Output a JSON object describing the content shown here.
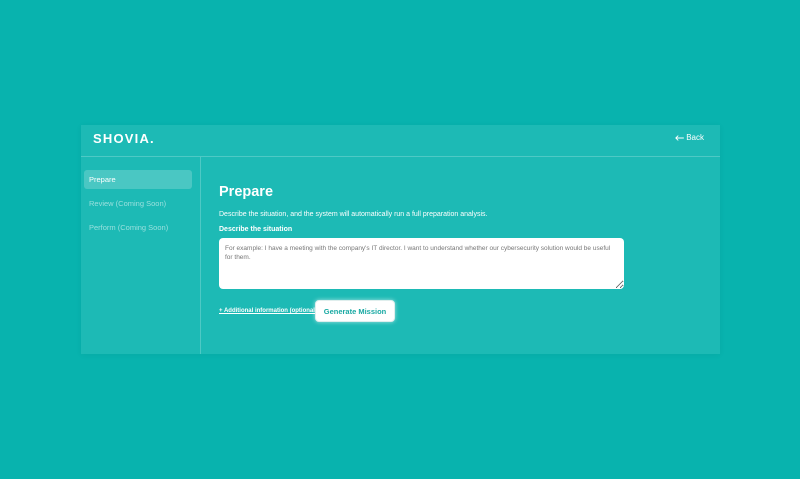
{
  "header": {
    "logo": "SHOVIA.",
    "back_label": "Back",
    "back_icon": "arrow-left-icon"
  },
  "sidebar": {
    "items": [
      {
        "label": "Prepare",
        "active": true
      },
      {
        "label": "Review (Coming Soon)",
        "active": false
      },
      {
        "label": "Perform (Coming Soon)",
        "active": false
      }
    ]
  },
  "main": {
    "title": "Prepare",
    "description": "Describe the situation, and the system will automatically run a full preparation analysis.",
    "field_label": "Describe the situation",
    "input_placeholder": "For example: I have a meeting with the company's IT director. I want to understand whether our cybersecurity solution would be useful for them.",
    "input_value": "",
    "additional_label": "+ Additional information (optional)",
    "generate_label": "Generate Mission"
  },
  "colors": {
    "page_background": "#08b3ae",
    "panel_background": "#1dbab5",
    "accent": "#19a9a3",
    "text": "#ffffff"
  }
}
